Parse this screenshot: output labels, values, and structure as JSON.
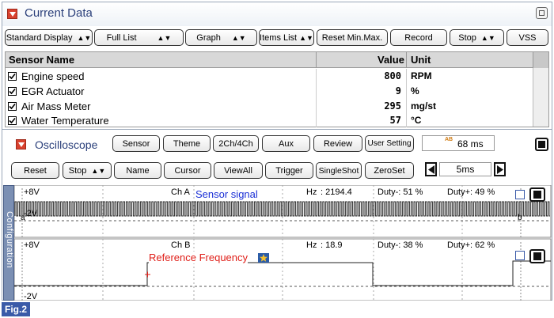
{
  "current_data": {
    "title": "Current Data",
    "toolbar": {
      "standard_display": "Standard Display",
      "full_list": "Full List",
      "graph": "Graph",
      "items_list": "Items List",
      "reset_min_max": "Reset Min.Max.",
      "record": "Record",
      "stop": "Stop",
      "vss": "VSS"
    },
    "table": {
      "headers": [
        "Sensor Name",
        "Value",
        "Unit"
      ],
      "rows": [
        {
          "name": "Engine speed",
          "value": "800",
          "unit": "RPM"
        },
        {
          "name": "EGR Actuator",
          "value": "9",
          "unit": "%"
        },
        {
          "name": "Air Mass Meter",
          "value": "295",
          "unit": "mg/st"
        },
        {
          "name": "Water Temperature",
          "value": "57",
          "unit": "°C"
        }
      ]
    }
  },
  "oscilloscope": {
    "title": "Oscilloscope",
    "toolbar1": {
      "sensor": "Sensor",
      "theme": "Theme",
      "channels": "2Ch/4Ch",
      "aux": "Aux",
      "review": "Review",
      "user_setting": "User Setting",
      "sample_badge": "AB",
      "sample_time": "68 ms"
    },
    "toolbar2": {
      "reset": "Reset",
      "stop": "Stop",
      "name": "Name",
      "cursor": "Cursor",
      "view_all": "ViewAll",
      "trigger": "Trigger",
      "single_shot": "SingleShot",
      "zero_set": "ZeroSet",
      "time_div": "5ms"
    },
    "side_tab": "Configuration",
    "channel_a": {
      "vmax": "+8V",
      "vmin": "-2V",
      "label": "Ch A",
      "name": "Sensor signal",
      "hz_label": "Hz",
      "hz": ": 2194.4",
      "duty_minus": "Duty-: 51 %",
      "duty_plus": "Duty+: 49 %",
      "cursor_a": "a",
      "cursor_b": "b"
    },
    "channel_b": {
      "vmax": "+8V",
      "vmin": "-2V",
      "label": "Ch B",
      "name": "Reference Frequency",
      "hz_label": "Hz",
      "hz": ": 18.9",
      "duty_minus": "Duty-: 38 %",
      "duty_plus": "Duty+: 62 %"
    }
  },
  "figure_label": "Fig.2",
  "colors": {
    "title_blue": "#2a3f7a",
    "accent_red": "#d9412e",
    "signal_blue": "#1a2fd6",
    "ref_red": "#e0201a",
    "fig_bg": "#3a5aa8"
  }
}
